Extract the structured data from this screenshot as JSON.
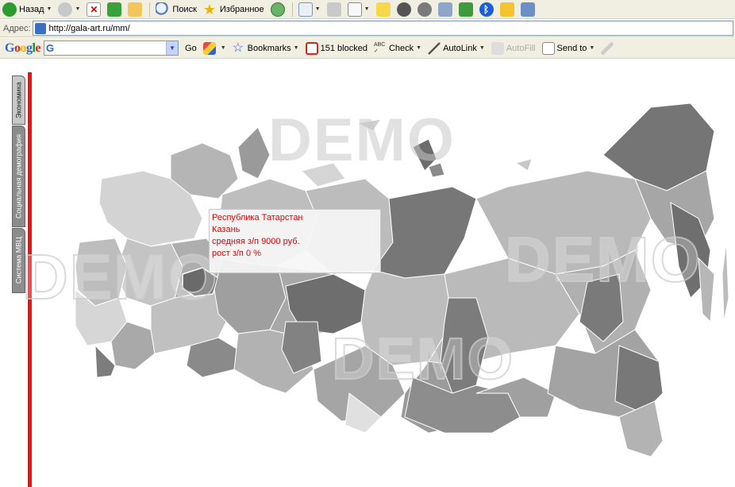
{
  "toolbar": {
    "back_label": "Назад",
    "search_label": "Поиск",
    "favorites_label": "Избранное"
  },
  "address": {
    "label": "Адрес:",
    "url": "http://gala-art.ru/mm/"
  },
  "google_bar": {
    "logo": "Google",
    "search_value": "G",
    "go_label": "Go",
    "bookmarks_label": "Bookmarks",
    "blocked_label": "151 blocked",
    "check_label": "Check",
    "autolink_label": "AutoLink",
    "autofill_label": "AutoFill",
    "sendto_label": "Send to"
  },
  "side_tabs": [
    {
      "label": "Экономика"
    },
    {
      "label": "Социальная демография"
    },
    {
      "label": "Система МВЦ"
    }
  ],
  "watermarks": [
    "DEMO",
    "DEMO",
    "DEMO",
    "DEMO"
  ],
  "tooltip": {
    "region": "Республика Татарстан",
    "city": "Казань",
    "salary": "средняя з/п 9000 руб.",
    "growth": "рост з/п 0 %"
  },
  "colors": {
    "accent_red": "#ef1010",
    "tooltip_text": "#e60000"
  }
}
